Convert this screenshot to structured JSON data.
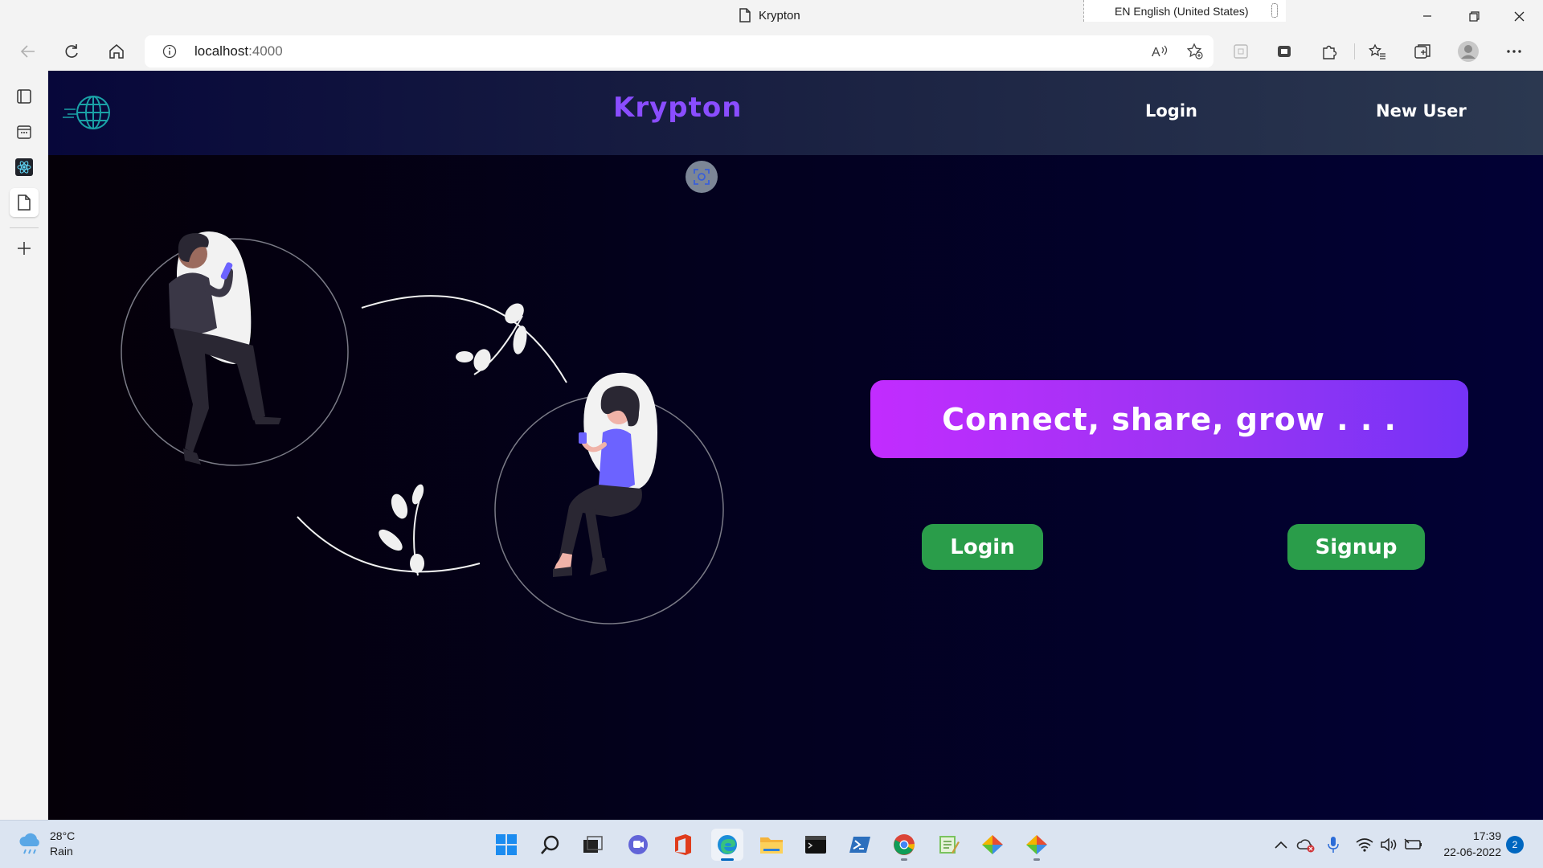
{
  "browser": {
    "tab_title": "Krypton",
    "language": "EN English (United States)",
    "url_host": "localhost",
    "url_port": ":4000"
  },
  "site": {
    "brand": "Krypton",
    "nav": {
      "login": "Login",
      "new_user": "New User"
    },
    "tagline": "Connect, share, grow . . .",
    "buttons": {
      "login": "Login",
      "signup": "Signup"
    }
  },
  "taskbar": {
    "weather": {
      "temp": "28°C",
      "condition": "Rain"
    },
    "time": "17:39",
    "date": "22-06-2022",
    "notifications": "2"
  },
  "colors": {
    "brand": "#8a4dff",
    "tagline_start": "#c22cff",
    "tagline_end": "#7533f7",
    "cta": "#2a9d4a",
    "accent_person": "#6c63ff"
  },
  "icons": {
    "sidebar": [
      "tab-actions-icon",
      "calendar-icon",
      "react-devtools-icon",
      "page-icon",
      "add-icon"
    ],
    "taskbar": [
      "windows-start-icon",
      "search-icon",
      "task-view-icon",
      "teams-chat-icon",
      "office-icon",
      "edge-icon",
      "file-explorer-icon",
      "terminal-icon",
      "powershell-icon",
      "chrome-icon",
      "notepad-icon",
      "git-icon",
      "git-icon"
    ]
  }
}
